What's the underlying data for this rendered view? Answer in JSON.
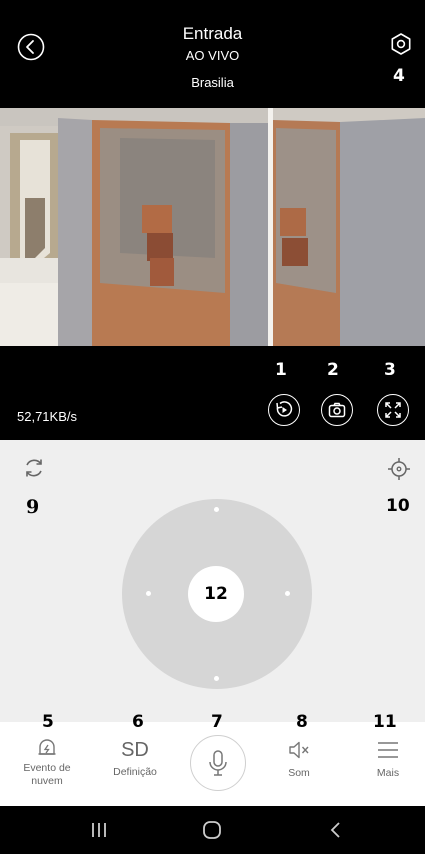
{
  "header": {
    "title": "Entrada",
    "status": "AO VIVO",
    "location": "Brasilia"
  },
  "stream": {
    "speed": "52,71KB/s"
  },
  "ptz": {
    "center_label": "12"
  },
  "tabs": {
    "cloud_event": "Evento de\nnuvem",
    "definition_value": "SD",
    "definition": "Definição",
    "sound": "Som",
    "more": "Mais"
  },
  "markers": {
    "m1": "1",
    "m2": "2",
    "m3": "3",
    "m4": "4",
    "m5": "5",
    "m6": "6",
    "m7": "7",
    "m8": "8",
    "m9": "9",
    "m10": "10",
    "m11": "11"
  },
  "icons": {
    "back": "chevron-left-icon",
    "settings": "gear-icon",
    "playback": "playback-icon",
    "snapshot": "camera-icon",
    "fullscreen": "expand-icon",
    "refresh": "refresh-icon",
    "locate": "crosshair-icon",
    "cloud_event": "cloud-alarm-icon",
    "mic": "microphone-icon",
    "sound": "speaker-mute-icon",
    "more": "menu-icon"
  },
  "colors": {
    "background": "#000000",
    "panel": "#efefef",
    "joystick": "#d6d6d6"
  }
}
